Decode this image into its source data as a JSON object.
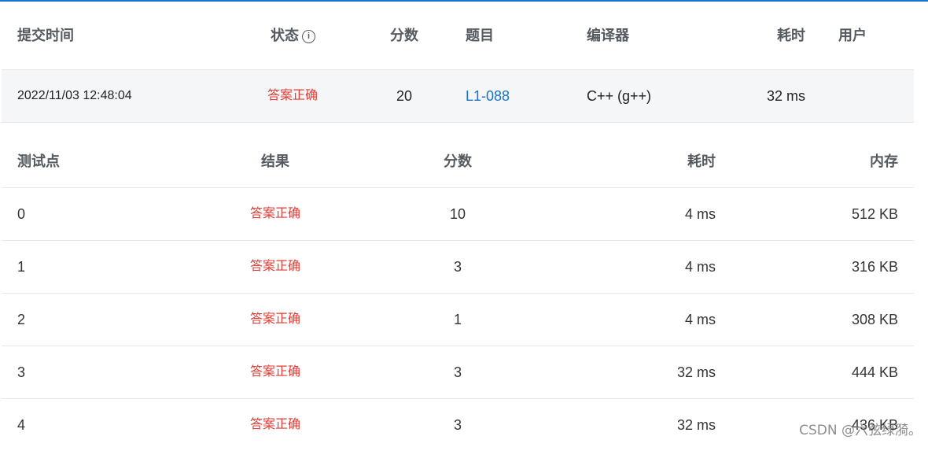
{
  "submission": {
    "headers": {
      "time": "提交时间",
      "status": "状态",
      "score": "分数",
      "problem": "题目",
      "compiler": "编译器",
      "duration": "耗时",
      "user": "用户"
    },
    "row": {
      "time": "2022/11/03 12:48:04",
      "status": "答案正确",
      "score": "20",
      "problem": "L1-088",
      "compiler": "C++ (g++)",
      "duration": "32 ms",
      "user": ""
    }
  },
  "testcases": {
    "headers": {
      "case": "测试点",
      "result": "结果",
      "score": "分数",
      "duration": "耗时",
      "memory": "内存"
    },
    "rows": [
      {
        "case": "0",
        "result": "答案正确",
        "score": "10",
        "duration": "4 ms",
        "memory": "512 KB"
      },
      {
        "case": "1",
        "result": "答案正确",
        "score": "3",
        "duration": "4 ms",
        "memory": "316 KB"
      },
      {
        "case": "2",
        "result": "答案正确",
        "score": "1",
        "duration": "4 ms",
        "memory": "308 KB"
      },
      {
        "case": "3",
        "result": "答案正确",
        "score": "3",
        "duration": "32 ms",
        "memory": "444 KB"
      },
      {
        "case": "4",
        "result": "答案正确",
        "score": "3",
        "duration": "32 ms",
        "memory": "436 KB"
      }
    ]
  },
  "icons": {
    "status_info": "info-icon"
  },
  "colors": {
    "accent": "#1a73c8",
    "accepted": "#e53b33",
    "row_highlight": "#f5f6f8"
  },
  "watermark": "CSDN @六弦绿漪。"
}
